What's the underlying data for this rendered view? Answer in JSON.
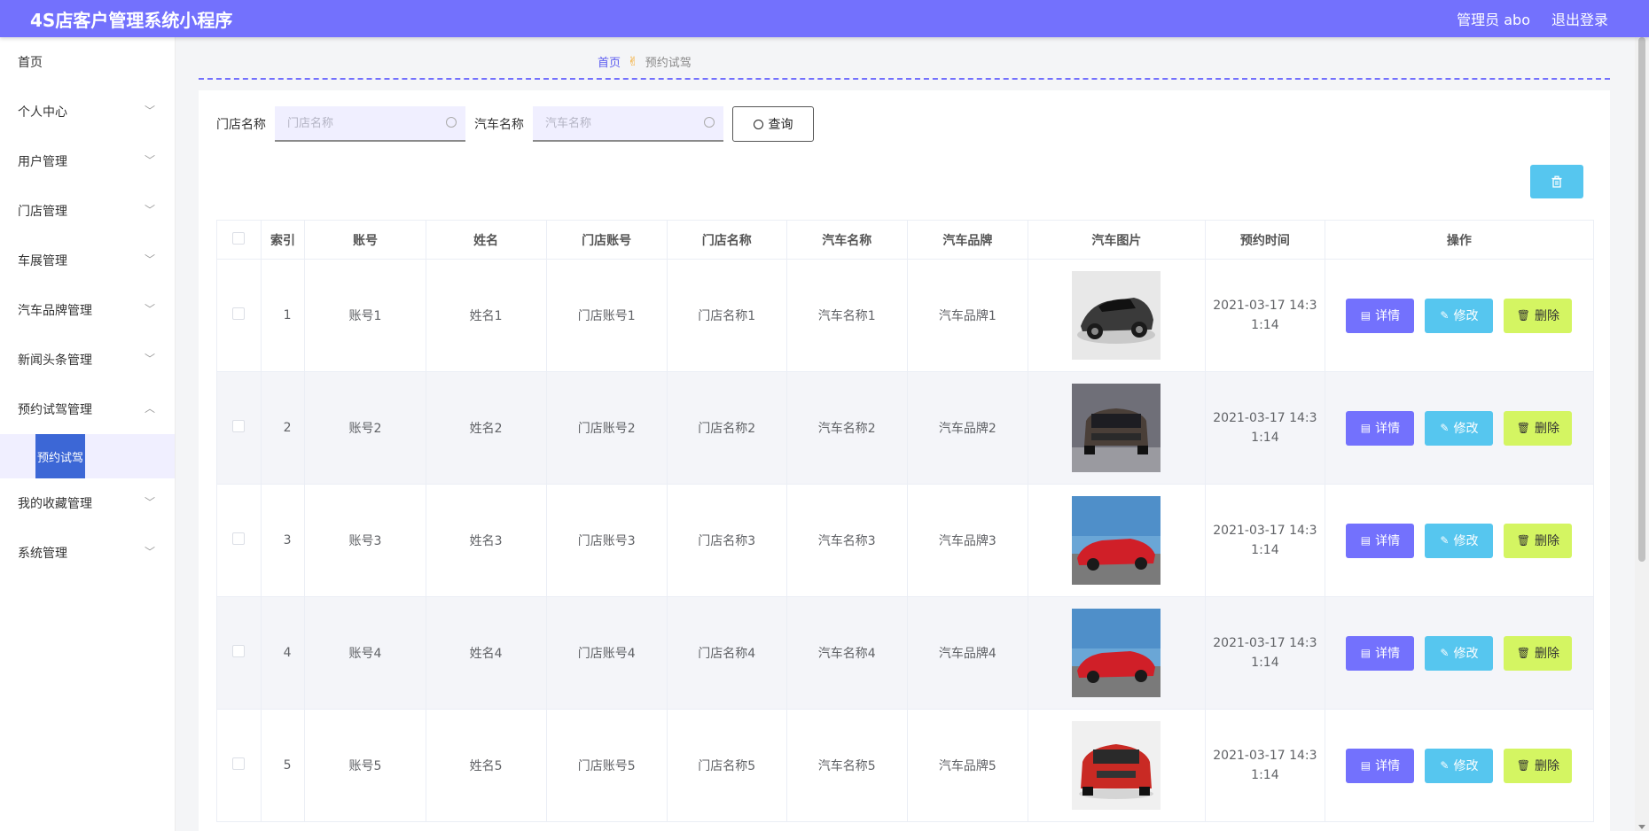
{
  "header": {
    "title": "4S店客户管理系统小程序",
    "user": "管理员 abo",
    "logout": "退出登录"
  },
  "sidebar": {
    "items": [
      {
        "label": "首页",
        "chevron": ""
      },
      {
        "label": "个人中心",
        "chevron": "﹀"
      },
      {
        "label": "用户管理",
        "chevron": "﹀"
      },
      {
        "label": "门店管理",
        "chevron": "﹀"
      },
      {
        "label": "车展管理",
        "chevron": "﹀"
      },
      {
        "label": "汽车品牌管理",
        "chevron": "﹀"
      },
      {
        "label": "新闻头条管理",
        "chevron": "﹀"
      },
      {
        "label": "预约试驾管理",
        "chevron": "︿"
      },
      {
        "label": "我的收藏管理",
        "chevron": "﹀"
      },
      {
        "label": "系统管理",
        "chevron": "﹀"
      }
    ],
    "submenu_active": "预约试驾"
  },
  "breadcrumb": {
    "home": "首页",
    "separator": "✌",
    "current": "预约试驾"
  },
  "search": {
    "store_label": "门店名称",
    "store_placeholder": "门店名称",
    "car_label": "汽车名称",
    "car_placeholder": "汽车名称",
    "query_button": "查询"
  },
  "table": {
    "headers": [
      "",
      "索引",
      "账号",
      "姓名",
      "门店账号",
      "门店名称",
      "汽车名称",
      "汽车品牌",
      "汽车图片",
      "预约时间",
      "操作"
    ],
    "rows": [
      {
        "index": "1",
        "account": "账号1",
        "name": "姓名1",
        "store_account": "门店账号1",
        "store_name": "门店名称1",
        "car_name": "汽车名称1",
        "car_brand": "汽车品牌1",
        "time_line1": "2021-03-17 14:3",
        "time_line2": "1:14"
      },
      {
        "index": "2",
        "account": "账号2",
        "name": "姓名2",
        "store_account": "门店账号2",
        "store_name": "门店名称2",
        "car_name": "汽车名称2",
        "car_brand": "汽车品牌2",
        "time_line1": "2021-03-17 14:3",
        "time_line2": "1:14"
      },
      {
        "index": "3",
        "account": "账号3",
        "name": "姓名3",
        "store_account": "门店账号3",
        "store_name": "门店名称3",
        "car_name": "汽车名称3",
        "car_brand": "汽车品牌3",
        "time_line1": "2021-03-17 14:3",
        "time_line2": "1:14"
      },
      {
        "index": "4",
        "account": "账号4",
        "name": "姓名4",
        "store_account": "门店账号4",
        "store_name": "门店名称4",
        "car_name": "汽车名称4",
        "car_brand": "汽车品牌4",
        "time_line1": "2021-03-17 14:3",
        "time_line2": "1:14"
      },
      {
        "index": "5",
        "account": "账号5",
        "name": "姓名5",
        "store_account": "门店账号5",
        "store_name": "门店名称5",
        "car_name": "汽车名称5",
        "car_brand": "汽车品牌5",
        "time_line1": "2021-03-17 14:3",
        "time_line2": "1:14"
      }
    ],
    "actions": {
      "detail": "详情",
      "edit": "修改",
      "delete": "删除"
    }
  },
  "colors": {
    "primary": "#7371fd",
    "edit": "#56c6ef",
    "delete": "#d4f562",
    "submenu_active": "#3c67d6"
  }
}
